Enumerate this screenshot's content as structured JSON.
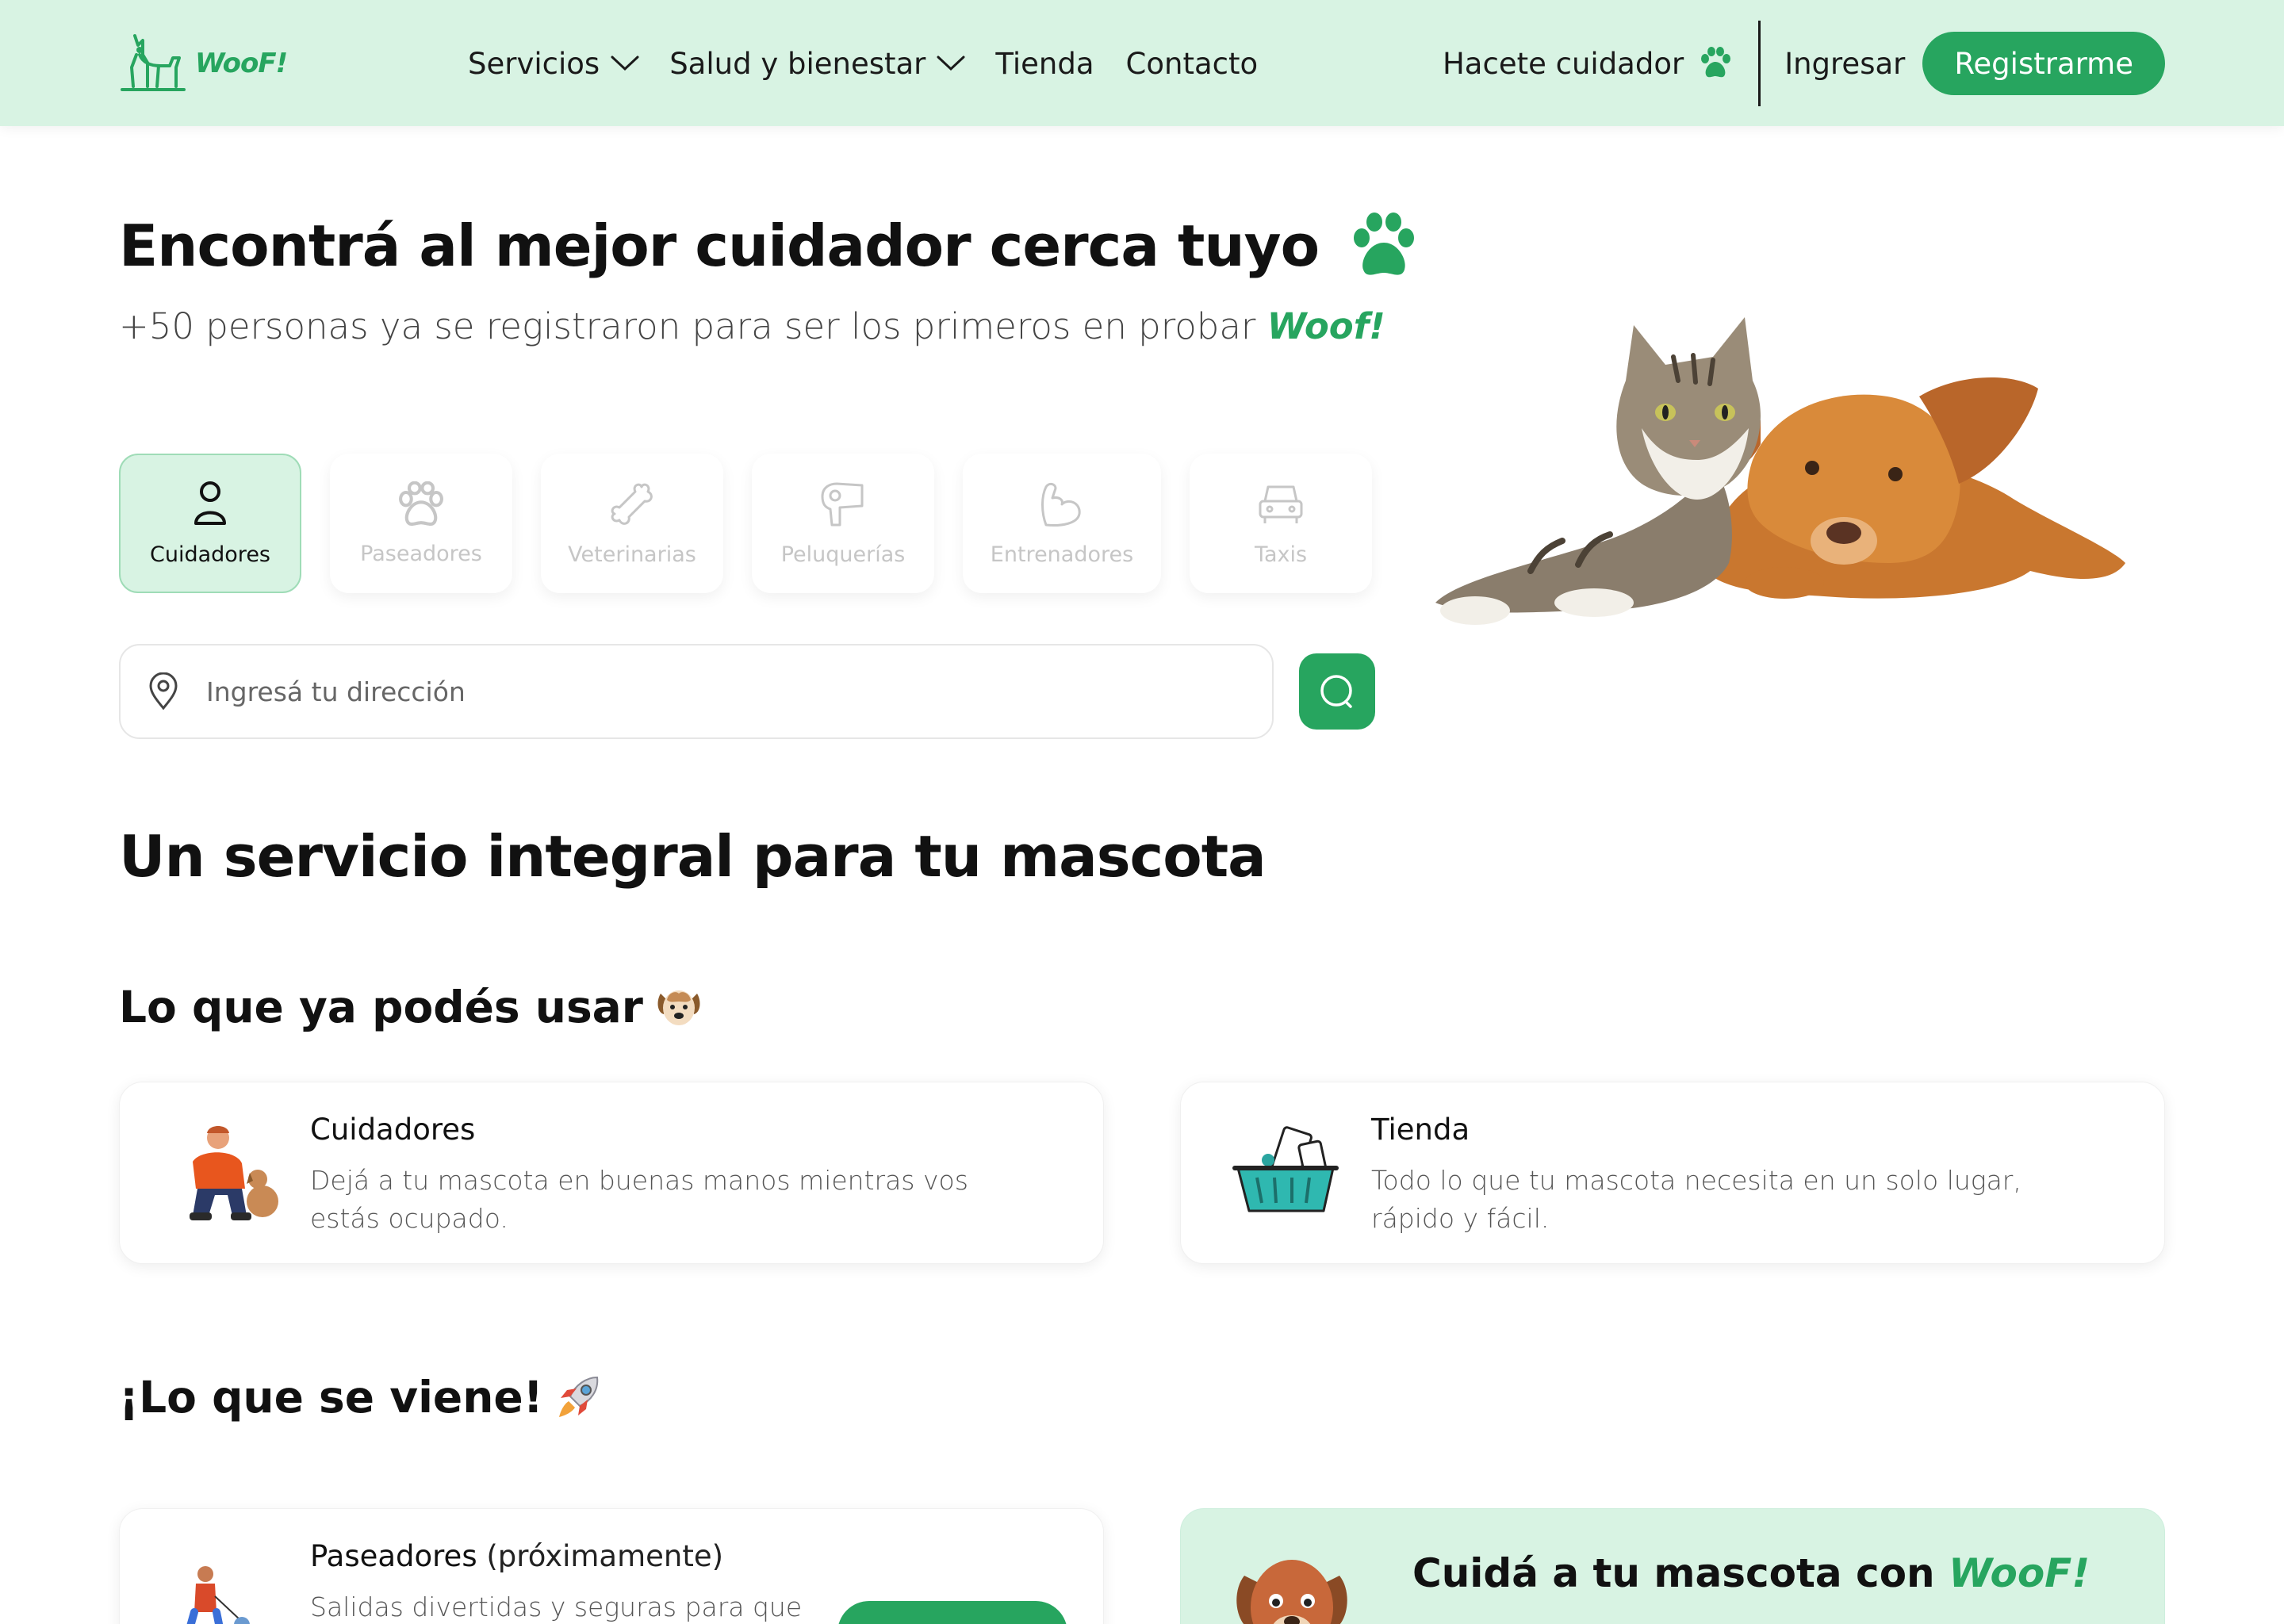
{
  "header": {
    "brand": "WooF!",
    "nav": [
      {
        "label": "Servicios",
        "has_dropdown": true
      },
      {
        "label": "Salud y bienestar",
        "has_dropdown": true
      },
      {
        "label": "Tienda",
        "has_dropdown": false
      },
      {
        "label": "Contacto",
        "has_dropdown": false
      }
    ],
    "caretaker_label": "Hacete cuidador",
    "login_label": "Ingresar",
    "register_label": "Registrarme"
  },
  "hero": {
    "title": "Encontrá al mejor cuidador cerca tuyo",
    "subtitle_prefix": "+50 personas ya se registraron para ser los primeros en probar ",
    "subtitle_brand": "Woof!",
    "tabs": [
      {
        "label": "Cuidadores",
        "icon": "person-icon",
        "active": true
      },
      {
        "label": "Paseadores",
        "icon": "paw-icon",
        "active": false
      },
      {
        "label": "Veterinarias",
        "icon": "bone-icon",
        "active": false
      },
      {
        "label": "Peluquerías",
        "icon": "hair-dryer-icon",
        "active": false
      },
      {
        "label": "Entrenadores",
        "icon": "muscle-icon",
        "active": false
      },
      {
        "label": "Taxis",
        "icon": "car-icon",
        "active": false
      }
    ],
    "search_placeholder": "Ingresá tu dirección"
  },
  "main": {
    "section_title": "Un servicio integral para tu mascota",
    "available_heading": "Lo que ya podés usar",
    "available_emoji": "🐶",
    "available_cards": [
      {
        "title": "Cuidadores",
        "desc": "Dejá a tu mascota en buenas manos mientras vos estás ocupado.",
        "icon": "caretaker-illustration-icon"
      },
      {
        "title": "Tienda",
        "desc": "Todo lo que tu mascota necesita en un solo lugar, rápido y fácil.",
        "icon": "shopping-basket-icon"
      }
    ],
    "upcoming_heading": "¡Lo que se viene!",
    "upcoming_emoji": "🚀",
    "upcoming_card": {
      "title": "Paseadores",
      "soon": "(próximamente)",
      "desc": "Salidas divertidas y seguras para que tu"
    },
    "promo": {
      "text": "Cuidá a tu mascota con ",
      "brand": "WooF!"
    }
  },
  "colors": {
    "accent": "#27a55f",
    "header_bg": "#d8f3e3"
  }
}
